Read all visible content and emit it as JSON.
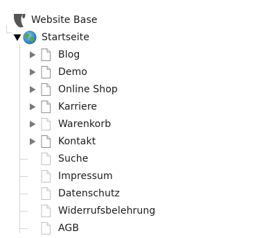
{
  "tree": {
    "root": {
      "label": "Website Base",
      "icon": "typo3-logo-icon"
    },
    "site": {
      "label": "Startseite",
      "icon": "globe-icon",
      "expanded": true
    },
    "pages": [
      {
        "label": "Blog",
        "has_children": true,
        "icon": "page-icon"
      },
      {
        "label": "Demo",
        "has_children": true,
        "icon": "page-icon"
      },
      {
        "label": "Online Shop",
        "has_children": true,
        "icon": "page-icon"
      },
      {
        "label": "Karriere",
        "has_children": true,
        "icon": "page-icon"
      },
      {
        "label": "Warenkorb",
        "has_children": true,
        "icon": "page-icon-hidden"
      },
      {
        "label": "Kontakt",
        "has_children": true,
        "icon": "page-icon"
      },
      {
        "label": "Suche",
        "has_children": false,
        "icon": "page-icon-hidden"
      },
      {
        "label": "Impressum",
        "has_children": false,
        "icon": "page-icon-hidden"
      },
      {
        "label": "Datenschutz",
        "has_children": false,
        "icon": "page-icon-hidden"
      },
      {
        "label": "Widerrufsbelehrung",
        "has_children": false,
        "icon": "page-icon-hidden"
      },
      {
        "label": "AGB",
        "has_children": false,
        "icon": "page-icon-hidden"
      }
    ]
  },
  "colors": {
    "text": "#1a1a1a",
    "connector": "#d4d4d4",
    "toggle_collapsed": "#7a7a7a",
    "toggle_expanded": "#000000",
    "page_outline": "#8c8c8c",
    "page_outline_hidden": "#c2c2c2",
    "logo": "#555555"
  }
}
